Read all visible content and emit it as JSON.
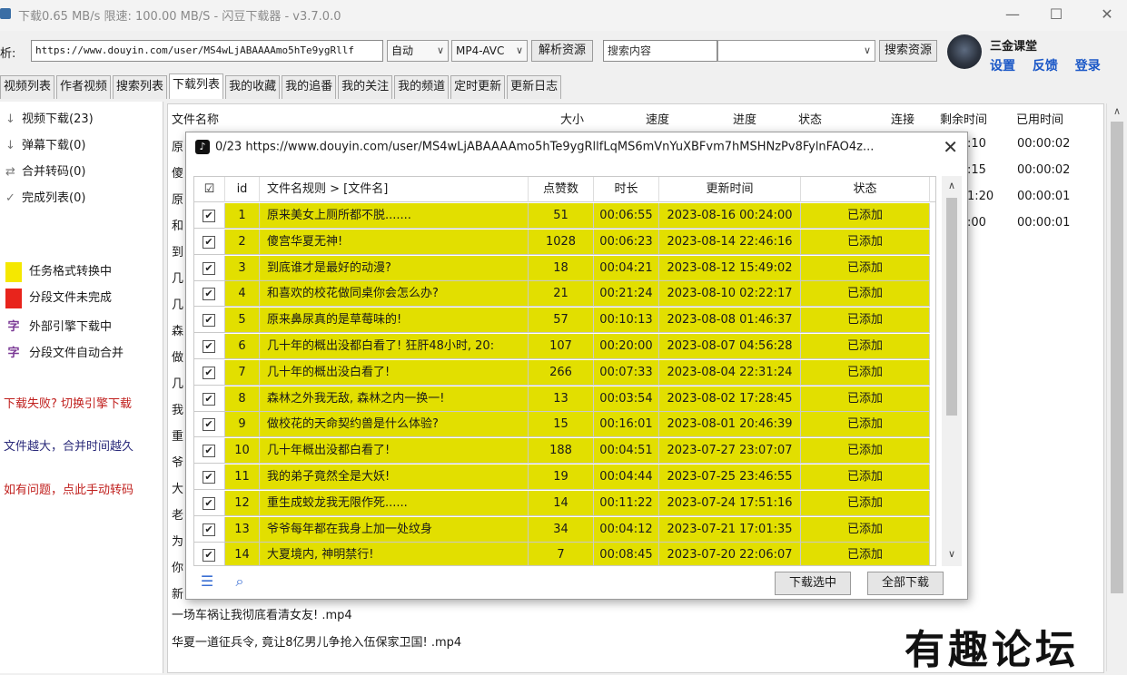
{
  "window": {
    "title": "下载0.65 MB/s  限速: 100.00 MB/S  - 闪豆下载器 - v3.7.0.0",
    "min_icon": "minimize-icon",
    "max_icon": "maximize-icon",
    "close_icon": "close-icon"
  },
  "toolbar": {
    "parse_label": "析:",
    "url_value": "https://www.douyin.com/user/MS4wLjABAAAAmo5hTe9ygRllf",
    "auto_select": "自动",
    "format_select": "MP4-AVC",
    "parse_button": "解析资源",
    "search_placeholder": "搜索内容",
    "search_select": "",
    "search_button": "搜索资源"
  },
  "user": {
    "name": "三金课堂",
    "links": [
      "设置",
      "反馈",
      "登录"
    ]
  },
  "tabs": [
    "视频列表",
    "作者视频",
    "搜索列表",
    "下载列表",
    "我的收藏",
    "我的追番",
    "我的关注",
    "我的频道",
    "定时更新",
    "更新日志"
  ],
  "active_tab": 3,
  "sidebar": {
    "items": [
      {
        "icon": "↓",
        "label": "视频下载(23)"
      },
      {
        "icon": "↓",
        "label": "弹幕下载(0)"
      },
      {
        "icon": "⇄",
        "label": "合并转码(0)"
      },
      {
        "icon": "✓",
        "label": "完成列表(0)"
      }
    ],
    "legend": [
      {
        "type": "swatch",
        "color": "#f5e800",
        "label": "任务格式转换中"
      },
      {
        "type": "swatch",
        "color": "#e8241c",
        "label": "分段文件未完成"
      },
      {
        "type": "glyph",
        "glyph": "字",
        "label": "外部引擎下载中"
      },
      {
        "type": "glyph",
        "glyph": "字",
        "label": "分段文件自动合并"
      }
    ],
    "tips": [
      "下载失败? 切换引擎下载",
      "文件越大，合并时间越久",
      "如有问题，点此手动转码"
    ]
  },
  "main": {
    "headers": [
      "文件名称",
      "大小",
      "速度",
      "进度",
      "状态",
      "连接",
      "剩余时间",
      "已用时间"
    ],
    "row_first_chars": [
      "原",
      "傻",
      "原",
      "和",
      "到",
      "几",
      "几",
      "森",
      "做",
      "几",
      "我",
      "重",
      "爷",
      "大",
      "老",
      "为",
      "你",
      "新"
    ],
    "times_remaining": [
      ":10",
      ":15",
      "1:20",
      ":00"
    ],
    "times_used": [
      "00:00:02",
      "00:00:02",
      "00:00:01",
      "00:00:01"
    ],
    "bottom_rows": [
      "一场车祸让我彻底看清女友! .mp4",
      "华夏一道征兵令, 竟让8亿男儿争抢入伍保家卫国! .mp4"
    ]
  },
  "dialog": {
    "tiktok_icon": "tiktok-icon",
    "title": "0/23 https://www.douyin.com/user/MS4wLjABAAAAmo5hTe9ygRllfLqMS6mVnYuXBFvm7hMSHNzPv8FylnFAO4z...",
    "headers": [
      "☑",
      "id",
      "文件名规则  >  [文件名]",
      "点赞数",
      "时长",
      "更新时间",
      "状态"
    ],
    "rows": [
      {
        "id": "1",
        "name": "原来美女上厕所都不脱.......",
        "likes": "51",
        "duration": "00:06:55",
        "updated": "2023-08-16 00:24:00",
        "status": "已添加"
      },
      {
        "id": "2",
        "name": "傻宫华夏无神!",
        "likes": "1028",
        "duration": "00:06:23",
        "updated": "2023-08-14 22:46:16",
        "status": "已添加"
      },
      {
        "id": "3",
        "name": "到底谁才是最好的动漫?",
        "likes": "18",
        "duration": "00:04:21",
        "updated": "2023-08-12 15:49:02",
        "status": "已添加"
      },
      {
        "id": "4",
        "name": "和喜欢的校花做同桌你会怎么办?",
        "likes": "21",
        "duration": "00:21:24",
        "updated": "2023-08-10 02:22:17",
        "status": "已添加"
      },
      {
        "id": "5",
        "name": "原来鼻尿真的是草莓味的!",
        "likes": "57",
        "duration": "00:10:13",
        "updated": "2023-08-08 01:46:37",
        "status": "已添加"
      },
      {
        "id": "6",
        "name": "几十年的概出没都白看了! 狂肝48小时, 20:",
        "likes": "107",
        "duration": "00:20:00",
        "updated": "2023-08-07 04:56:28",
        "status": "已添加"
      },
      {
        "id": "7",
        "name": "几十年的概出没白看了!",
        "likes": "266",
        "duration": "00:07:33",
        "updated": "2023-08-04 22:31:24",
        "status": "已添加"
      },
      {
        "id": "8",
        "name": "森林之外我无敌, 森林之内一换一!",
        "likes": "13",
        "duration": "00:03:54",
        "updated": "2023-08-02 17:28:45",
        "status": "已添加"
      },
      {
        "id": "9",
        "name": "做校花的天命契约兽是什么体验?",
        "likes": "15",
        "duration": "00:16:01",
        "updated": "2023-08-01 20:46:39",
        "status": "已添加"
      },
      {
        "id": "10",
        "name": "几十年概出没都白看了!",
        "likes": "188",
        "duration": "00:04:51",
        "updated": "2023-07-27 23:07:07",
        "status": "已添加"
      },
      {
        "id": "11",
        "name": "我的弟子竟然全是大妖!",
        "likes": "19",
        "duration": "00:04:44",
        "updated": "2023-07-25 23:46:55",
        "status": "已添加"
      },
      {
        "id": "12",
        "name": "重生成蛟龙我无限作死......",
        "likes": "14",
        "duration": "00:11:22",
        "updated": "2023-07-24 17:51:16",
        "status": "已添加"
      },
      {
        "id": "13",
        "name": "爷爷每年都在我身上加一处纹身",
        "likes": "34",
        "duration": "00:04:12",
        "updated": "2023-07-21 17:01:35",
        "status": "已添加"
      },
      {
        "id": "14",
        "name": "大夏境内, 神明禁行!",
        "likes": "7",
        "duration": "00:08:45",
        "updated": "2023-07-20 22:06:07",
        "status": "已添加"
      }
    ],
    "highlight_color": "#e2df00",
    "bottom_icons": [
      "list-export-icon",
      "list-search-icon"
    ],
    "download_selected": "下载选中",
    "download_all": "全部下载"
  },
  "watermark": "有趣论坛"
}
